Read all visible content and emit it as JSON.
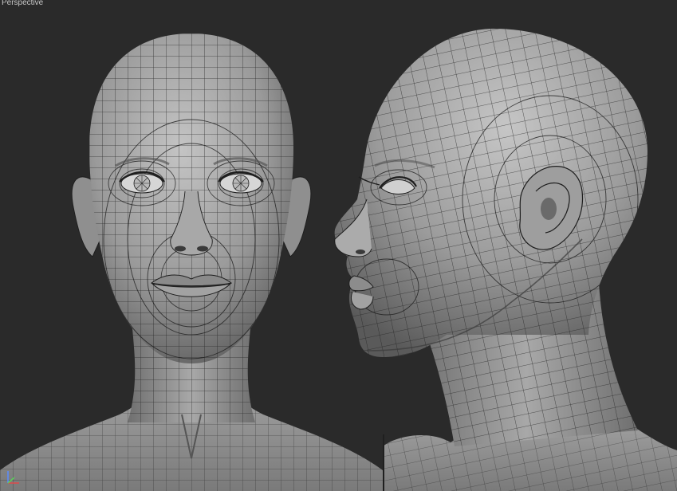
{
  "viewport": {
    "label": "Perspective",
    "background": "#2a2a2a"
  },
  "models": [
    {
      "name": "front-head",
      "view": "front"
    },
    {
      "name": "side-head",
      "view": "profile"
    }
  ],
  "colors": {
    "skin_light": "#bdbdbd",
    "skin_mid": "#8e8e8e",
    "skin_dark": "#5a5a5a",
    "wire": "#1e1e1e"
  },
  "icons": {
    "axis": "axis-gizmo-icon"
  }
}
